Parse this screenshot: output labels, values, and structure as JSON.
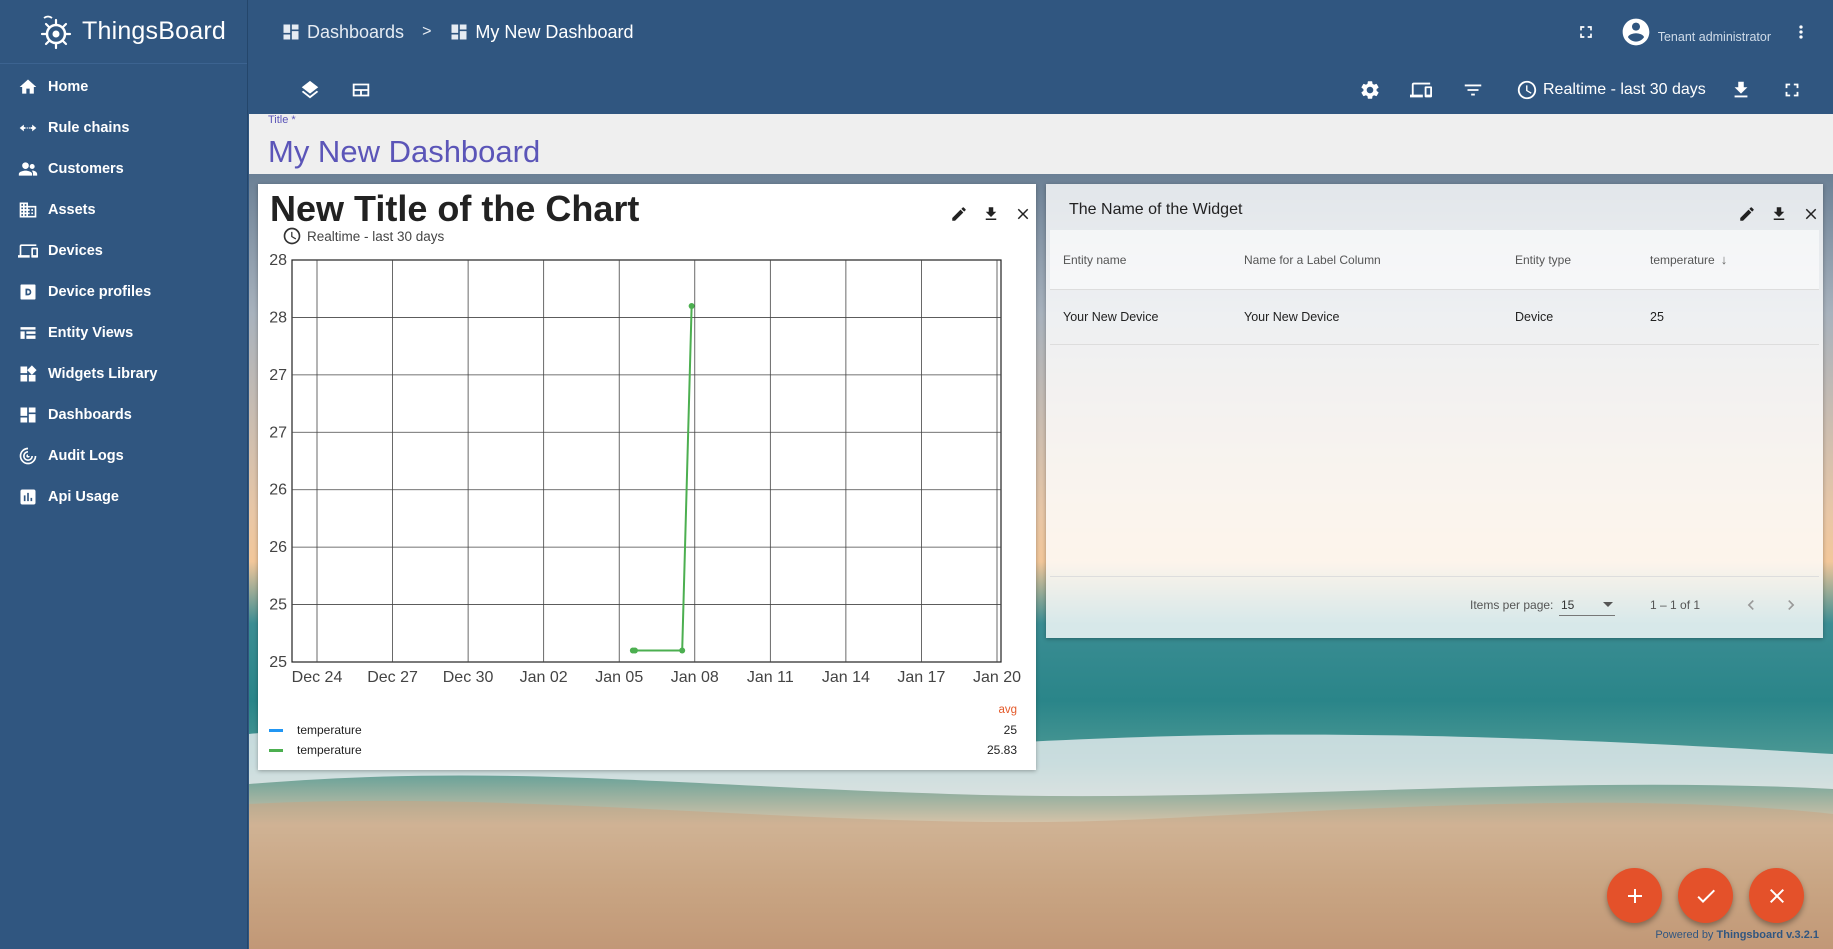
{
  "app": {
    "name": "ThingsBoard"
  },
  "sidebar": {
    "items": [
      {
        "label": "Home",
        "icon": "home-icon"
      },
      {
        "label": "Rule chains",
        "icon": "rule-chains-icon"
      },
      {
        "label": "Customers",
        "icon": "customers-icon"
      },
      {
        "label": "Assets",
        "icon": "assets-icon"
      },
      {
        "label": "Devices",
        "icon": "devices-icon"
      },
      {
        "label": "Device profiles",
        "icon": "device-profiles-icon"
      },
      {
        "label": "Entity Views",
        "icon": "entity-views-icon"
      },
      {
        "label": "Widgets Library",
        "icon": "widgets-library-icon"
      },
      {
        "label": "Dashboards",
        "icon": "dashboards-icon"
      },
      {
        "label": "Audit Logs",
        "icon": "audit-logs-icon"
      },
      {
        "label": "Api Usage",
        "icon": "api-usage-icon"
      }
    ]
  },
  "header": {
    "breadcrumb": [
      {
        "label": "Dashboards",
        "icon": "dashboards-icon"
      },
      {
        "label": "My New Dashboard",
        "icon": "dashboard-icon"
      }
    ],
    "separator": ">",
    "user": "Tenant administrator"
  },
  "toolbar": {
    "timewindow": "Realtime - last 30 days"
  },
  "title_field": {
    "label": "Title *",
    "value": "My New Dashboard"
  },
  "chart_widget": {
    "title": "New Title of the Chart",
    "timewindow": "Realtime - last 30 days",
    "legend": {
      "header": "avg",
      "rows": [
        {
          "label": "temperature",
          "value": "25",
          "color": "#2196f3"
        },
        {
          "label": "temperature",
          "value": "25.83",
          "color": "#4caf50"
        }
      ]
    }
  },
  "chart_data": {
    "type": "line",
    "xticks": [
      "Dec 24",
      "Dec 27",
      "Dec 30",
      "Jan 02",
      "Jan 05",
      "Jan 08",
      "Jan 11",
      "Jan 14",
      "Jan 17",
      "Jan 20"
    ],
    "yticks": [
      "28",
      "28",
      "27",
      "27",
      "26",
      "26",
      "25",
      "25"
    ],
    "ylim": [
      24.9,
      28.4
    ],
    "grid": true,
    "series": [
      {
        "name": "temperature",
        "color": "#4caf50",
        "points": [
          {
            "x": "2022-01-05T13:00",
            "y": 25
          },
          {
            "x": "2022-01-05T15:00",
            "y": 25
          },
          {
            "x": "2022-01-07T12:00",
            "y": 25
          },
          {
            "x": "2022-01-07T21:00",
            "y": 28
          }
        ]
      }
    ]
  },
  "table_widget": {
    "title": "The Name of the Widget",
    "columns": [
      "Entity name",
      "Name for a Label Column",
      "Entity type",
      "temperature"
    ],
    "sort_indicator": "↓",
    "rows": [
      [
        "Your New Device",
        "Your New Device",
        "Device",
        "25"
      ]
    ],
    "items_per_page_label": "Items per page:",
    "items_per_page": "15",
    "range": "1 – 1 of 1"
  },
  "footer": {
    "powered_prefix": "Powered by",
    "powered_brand": "Thingsboard v.3.2.1"
  },
  "colors": {
    "primary": "#305680",
    "accent": "#e4512a",
    "title": "#5b55b8"
  }
}
